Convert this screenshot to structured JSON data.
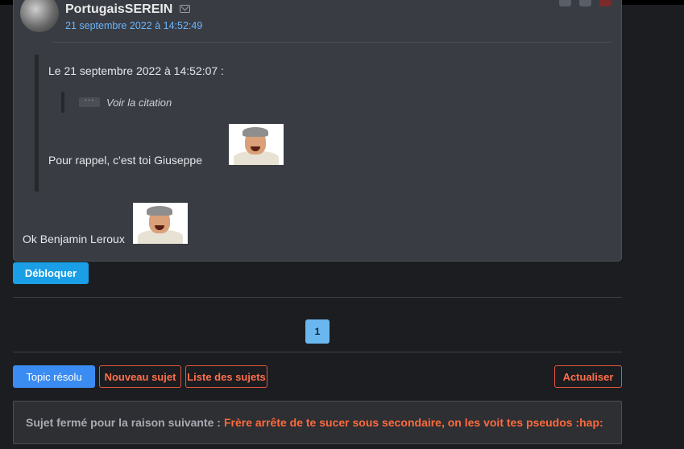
{
  "post": {
    "author": "PortugaisSEREIN",
    "date": "21 septembre 2022 à 14:52:49",
    "quote": {
      "header": "Le 21 septembre 2022 à 14:52:07 :",
      "collapsed_quote_label": "Voir la citation",
      "text": "Pour rappel, c'est toi Giuseppe"
    },
    "message": "Ok Benjamin Leroux"
  },
  "actions": {
    "debloquer": "Débloquer"
  },
  "pagination": {
    "current_page": "1"
  },
  "toolbar": {
    "topic_resolu": "Topic résolu",
    "nouveau_sujet": "Nouveau sujet",
    "liste_sujets": "Liste des sujets",
    "actualiser": "Actualiser"
  },
  "closed_notice": {
    "label": "Sujet fermé pour la raison suivante :",
    "reason": "Frère arrête de te sucer sous secondaire, on les voit tes pseudos :hap:"
  },
  "colors": {
    "accent_blue": "#1a9ee6",
    "danger": "#ff6a3d",
    "date_link": "#6bb6ff"
  },
  "icons": [
    "mail-icon",
    "ellipsis-icon"
  ]
}
